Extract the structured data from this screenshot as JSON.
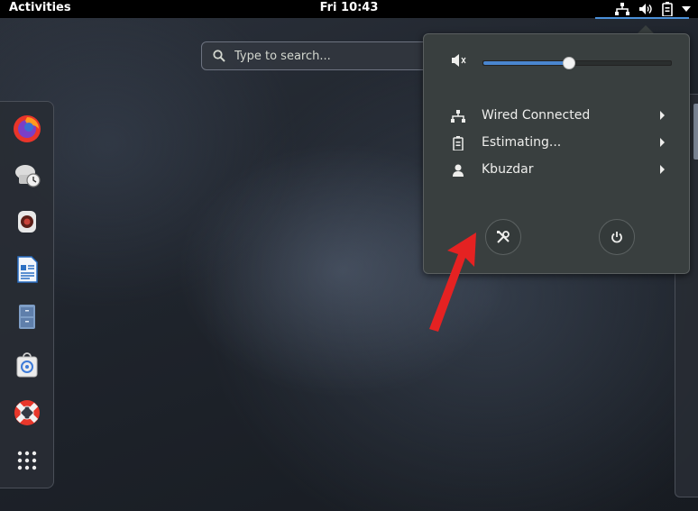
{
  "topbar": {
    "activities_label": "Activities",
    "clock": "Fri 10:43",
    "tray_icons": [
      "network-wired-icon",
      "audio-volume-icon",
      "battery-icon",
      "chevron-down-icon"
    ]
  },
  "search": {
    "placeholder": "Type to search..."
  },
  "dash": {
    "items": [
      {
        "name": "firefox-icon"
      },
      {
        "name": "evolution-icon"
      },
      {
        "name": "cheese-icon"
      },
      {
        "name": "writer-icon"
      },
      {
        "name": "files-icon"
      },
      {
        "name": "software-icon"
      },
      {
        "name": "help-icon"
      },
      {
        "name": "show-applications-icon"
      }
    ]
  },
  "system_menu": {
    "volume": {
      "level": 0.45,
      "icon": "audio-volume-low-icon"
    },
    "rows": [
      {
        "label": "Wired Connected",
        "icon": "network-wired-icon"
      },
      {
        "label": "Estimating...",
        "icon": "battery-icon"
      },
      {
        "label": "Kbuzdar",
        "icon": "user-icon"
      }
    ],
    "buttons": [
      {
        "name": "settings-button",
        "icon": "settings-tools-icon"
      },
      {
        "name": "power-button",
        "icon": "power-icon"
      }
    ]
  },
  "colors": {
    "accent": "#4a86cf",
    "menu_bg": "#393f3f",
    "annotation_arrow": "#e52222"
  }
}
